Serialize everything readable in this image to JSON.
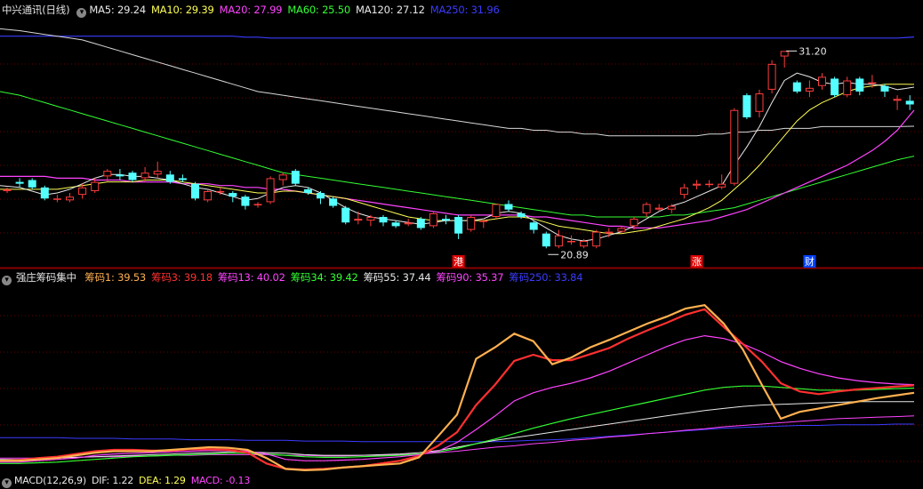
{
  "main_legend": {
    "stock_name": "中兴通讯(日线)",
    "items": [
      {
        "text": "MA5: 29.24",
        "color": "#e8e8e8"
      },
      {
        "text": "MA10: 29.39",
        "color": "#ffff55"
      },
      {
        "text": "MA20: 27.99",
        "color": "#ff44ff"
      },
      {
        "text": "MA60: 25.50",
        "color": "#33ff33"
      },
      {
        "text": "MA120: 27.12",
        "color": "#e8e8e8"
      },
      {
        "text": "MA250: 31.96",
        "color": "#3b3bff"
      }
    ]
  },
  "ind_legend": {
    "name": "强庄筹码集中",
    "items": [
      {
        "text": "筹码1: 39.53",
        "color": "#ffb14f"
      },
      {
        "text": "筹码3: 39.18",
        "color": "#ff3030"
      },
      {
        "text": "筹码13: 40.02",
        "color": "#ff44ff"
      },
      {
        "text": "筹码34: 39.42",
        "color": "#33ff33"
      },
      {
        "text": "筹码55: 37.44",
        "color": "#e8e8e8"
      },
      {
        "text": "筹码90: 35.37",
        "color": "#ff44ff"
      },
      {
        "text": "筹码250: 33.84",
        "color": "#3b3bff"
      }
    ]
  },
  "macd_legend": {
    "items": [
      {
        "text": "MACD(12,26,9)",
        "color": "#e8e8e8"
      },
      {
        "text": "DIF: 1.22",
        "color": "#e8e8e8"
      },
      {
        "text": "DEA: 1.29",
        "color": "#ffff55"
      },
      {
        "text": "MACD: -0.13",
        "color": "#ff44ff"
      }
    ]
  },
  "price_labels": {
    "high": "31.20",
    "low": "20.89"
  },
  "markers": [
    {
      "text": "港",
      "index": 36
    },
    {
      "text": "涨",
      "index": 55
    },
    {
      "text": "财",
      "index": 64
    }
  ],
  "chart_data": {
    "type": "candlestick",
    "y_range": [
      19.5,
      33.0
    ],
    "candles": [
      [
        23.6,
        23.7,
        23.8,
        23.5
      ],
      [
        24.1,
        24.0,
        24.3,
        23.8
      ],
      [
        24.2,
        23.8,
        24.3,
        23.7
      ],
      [
        23.8,
        23.2,
        23.9,
        23.1
      ],
      [
        23.2,
        23.2,
        23.4,
        23.0
      ],
      [
        23.1,
        23.3,
        23.5,
        23.0
      ],
      [
        23.4,
        23.8,
        24.0,
        23.2
      ],
      [
        23.6,
        24.1,
        24.3,
        23.5
      ],
      [
        24.4,
        24.7,
        24.8,
        24.1
      ],
      [
        24.5,
        24.4,
        24.8,
        24.2
      ],
      [
        24.6,
        24.2,
        24.7,
        24.1
      ],
      [
        24.3,
        24.6,
        24.9,
        24.1
      ],
      [
        24.5,
        24.7,
        25.2,
        24.3
      ],
      [
        24.5,
        24.1,
        24.7,
        24.0
      ],
      [
        24.3,
        24.2,
        24.5,
        24.1
      ],
      [
        24.0,
        23.2,
        24.1,
        23.1
      ],
      [
        23.1,
        23.6,
        23.7,
        23.0
      ],
      [
        23.6,
        23.6,
        23.8,
        23.4
      ],
      [
        23.5,
        23.3,
        23.6,
        23.0
      ],
      [
        23.3,
        22.8,
        23.4,
        22.6
      ],
      [
        22.9,
        22.9,
        23.0,
        22.7
      ],
      [
        23.0,
        24.3,
        24.4,
        22.9
      ],
      [
        24.2,
        24.5,
        24.6,
        23.9
      ],
      [
        24.7,
        24.0,
        24.8,
        23.9
      ],
      [
        23.7,
        23.5,
        23.8,
        23.4
      ],
      [
        23.5,
        23.2,
        23.6,
        22.9
      ],
      [
        23.2,
        22.8,
        23.3,
        22.7
      ],
      [
        22.7,
        21.9,
        22.8,
        21.8
      ],
      [
        22.0,
        22.1,
        22.5,
        21.8
      ],
      [
        22.0,
        22.2,
        22.3,
        21.7
      ],
      [
        22.2,
        21.9,
        22.3,
        21.7
      ],
      [
        21.9,
        21.7,
        22.0,
        21.6
      ],
      [
        21.8,
        21.9,
        22.1,
        21.7
      ],
      [
        22.1,
        21.6,
        22.2,
        21.5
      ],
      [
        21.7,
        22.4,
        22.5,
        21.6
      ],
      [
        22.1,
        22.0,
        22.3,
        21.8
      ],
      [
        22.2,
        21.3,
        22.3,
        21.0
      ],
      [
        21.5,
        22.2,
        22.3,
        21.4
      ],
      [
        22.0,
        22.0,
        22.1,
        21.6
      ],
      [
        22.2,
        22.9,
        22.9,
        22.1
      ],
      [
        22.9,
        22.6,
        23.1,
        22.5
      ],
      [
        22.4,
        22.2,
        22.5,
        22.1
      ],
      [
        21.9,
        21.5,
        22.0,
        21.3
      ],
      [
        21.3,
        20.6,
        21.4,
        20.5
      ],
      [
        20.6,
        21.2,
        21.5,
        20.5
      ],
      [
        20.9,
        20.9,
        21.2,
        20.7
      ],
      [
        20.6,
        20.9,
        21.0,
        20.5
      ],
      [
        20.6,
        21.4,
        21.5,
        20.5
      ],
      [
        21.3,
        21.4,
        21.6,
        21.1
      ],
      [
        21.4,
        21.6,
        21.7,
        21.3
      ],
      [
        21.7,
        22.1,
        22.2,
        21.5
      ],
      [
        22.4,
        22.9,
        23.0,
        22.2
      ],
      [
        22.6,
        22.7,
        22.9,
        22.5
      ],
      [
        22.6,
        22.8,
        22.9,
        22.4
      ],
      [
        23.4,
        23.8,
        24.0,
        23.2
      ],
      [
        23.9,
        24.0,
        24.2,
        23.7
      ],
      [
        24.0,
        24.0,
        24.2,
        23.8
      ],
      [
        23.8,
        24.0,
        24.5,
        23.7
      ],
      [
        24.0,
        28.0,
        28.1,
        23.9
      ],
      [
        28.8,
        27.6,
        28.9,
        27.5
      ],
      [
        27.9,
        28.9,
        29.1,
        27.6
      ],
      [
        29.1,
        30.5,
        30.7,
        28.9
      ],
      [
        30.9,
        31.2,
        31.2,
        30.3
      ],
      [
        29.5,
        29.0,
        29.6,
        28.9
      ],
      [
        29.0,
        29.2,
        29.6,
        28.7
      ],
      [
        29.3,
        29.8,
        30.0,
        29.1
      ],
      [
        29.7,
        28.8,
        29.8,
        28.7
      ],
      [
        28.8,
        29.6,
        29.8,
        28.7
      ],
      [
        29.7,
        29.0,
        29.8,
        28.8
      ],
      [
        29.5,
        29.5,
        29.9,
        29.2
      ],
      [
        29.3,
        29.0,
        29.4,
        28.7
      ],
      [
        28.5,
        28.6,
        28.8,
        28.0
      ],
      [
        28.5,
        28.3,
        28.8,
        28.0
      ]
    ],
    "ma5": [
      23.9,
      23.8,
      23.6,
      23.4,
      23.5,
      23.7,
      24.0,
      24.3,
      24.5,
      24.5,
      24.4,
      24.4,
      24.3,
      24.2,
      24.0,
      23.8,
      23.7,
      23.5,
      23.3,
      23.1,
      23.2,
      23.5,
      23.8,
      23.9,
      23.8,
      23.5,
      23.1,
      22.7,
      22.4,
      22.2,
      22.1,
      22.0,
      21.9,
      21.8,
      21.9,
      22.0,
      22.0,
      22.0,
      22.1,
      22.4,
      22.5,
      22.4,
      22.0,
      21.6,
      21.2,
      21.0,
      20.9,
      21.0,
      21.2,
      21.4,
      21.7,
      22.1,
      22.5,
      22.8,
      23.0,
      23.3,
      23.6,
      23.9,
      25.0,
      26.0,
      27.1,
      28.4,
      29.6,
      30.0,
      29.8,
      29.5,
      29.4,
      29.5,
      29.4,
      29.4,
      29.3,
      29.1,
      29.24
    ],
    "ma10": [
      23.7,
      23.7,
      23.7,
      23.7,
      23.7,
      23.8,
      23.9,
      24.0,
      24.1,
      24.1,
      24.1,
      24.2,
      24.2,
      24.2,
      24.1,
      24.0,
      23.9,
      23.8,
      23.7,
      23.6,
      23.5,
      23.5,
      23.6,
      23.6,
      23.5,
      23.4,
      23.3,
      23.2,
      23.0,
      22.8,
      22.6,
      22.4,
      22.2,
      22.1,
      22.0,
      22.0,
      22.0,
      22.0,
      22.0,
      22.1,
      22.2,
      22.2,
      22.1,
      21.9,
      21.7,
      21.6,
      21.5,
      21.4,
      21.3,
      21.3,
      21.4,
      21.5,
      21.7,
      21.9,
      22.1,
      22.4,
      22.7,
      23.1,
      23.7,
      24.3,
      25.0,
      25.8,
      26.6,
      27.4,
      28.0,
      28.4,
      28.7,
      29.0,
      29.2,
      29.3,
      29.4,
      29.4,
      29.39
    ],
    "ma20": [
      24.4,
      24.4,
      24.4,
      24.4,
      24.3,
      24.3,
      24.3,
      24.2,
      24.2,
      24.2,
      24.1,
      24.1,
      24.1,
      24.1,
      24.0,
      24.0,
      24.0,
      23.9,
      23.9,
      23.8,
      23.8,
      23.7,
      23.7,
      23.6,
      23.5,
      23.4,
      23.3,
      23.2,
      23.1,
      23.0,
      22.9,
      22.8,
      22.7,
      22.6,
      22.5,
      22.4,
      22.3,
      22.3,
      22.3,
      22.3,
      22.3,
      22.3,
      22.2,
      22.2,
      22.1,
      22.0,
      21.9,
      21.8,
      21.7,
      21.7,
      21.6,
      21.6,
      21.6,
      21.7,
      21.8,
      21.9,
      22.0,
      22.2,
      22.4,
      22.6,
      22.9,
      23.2,
      23.5,
      23.8,
      24.1,
      24.4,
      24.7,
      25.0,
      25.4,
      25.8,
      26.3,
      26.9,
      27.99
    ],
    "ma60": [
      29.0,
      28.8,
      28.6,
      28.4,
      28.2,
      28.0,
      27.8,
      27.6,
      27.4,
      27.2,
      27.0,
      26.8,
      26.6,
      26.4,
      26.2,
      26.0,
      25.8,
      25.6,
      25.4,
      25.2,
      25.0,
      24.8,
      24.6,
      24.5,
      24.4,
      24.3,
      24.2,
      24.1,
      24.0,
      23.9,
      23.8,
      23.7,
      23.6,
      23.5,
      23.4,
      23.3,
      23.2,
      23.1,
      23.0,
      22.9,
      22.8,
      22.7,
      22.6,
      22.5,
      22.4,
      22.3,
      22.3,
      22.2,
      22.2,
      22.2,
      22.2,
      22.2,
      22.2,
      22.3,
      22.3,
      22.4,
      22.5,
      22.6,
      22.7,
      22.9,
      23.1,
      23.3,
      23.5,
      23.7,
      23.9,
      24.1,
      24.3,
      24.5,
      24.7,
      24.9,
      25.1,
      25.3,
      25.5
    ],
    "ma120": [
      32.4,
      32.3,
      32.2,
      32.1,
      32.0,
      31.9,
      31.8,
      31.6,
      31.4,
      31.2,
      31.0,
      30.8,
      30.6,
      30.4,
      30.2,
      30.0,
      29.8,
      29.6,
      29.4,
      29.2,
      29.0,
      28.9,
      28.8,
      28.7,
      28.6,
      28.5,
      28.4,
      28.3,
      28.2,
      28.1,
      28.0,
      27.9,
      27.8,
      27.7,
      27.6,
      27.5,
      27.4,
      27.3,
      27.2,
      27.1,
      27.0,
      27.0,
      26.9,
      26.9,
      26.8,
      26.8,
      26.7,
      26.7,
      26.6,
      26.6,
      26.6,
      26.6,
      26.6,
      26.6,
      26.6,
      26.6,
      26.7,
      26.7,
      26.8,
      26.8,
      26.9,
      26.9,
      27.0,
      27.0,
      27.0,
      27.1,
      27.1,
      27.1,
      27.1,
      27.1,
      27.1,
      27.1,
      27.12
    ],
    "ma250": [
      32.0,
      32.0,
      32.0,
      32.0,
      32.0,
      32.0,
      32.0,
      32.0,
      32.0,
      32.0,
      32.0,
      32.0,
      32.0,
      32.0,
      32.0,
      32.0,
      32.0,
      32.0,
      32.0,
      31.95,
      31.95,
      31.9,
      31.9,
      31.9,
      31.9,
      31.9,
      31.9,
      31.9,
      31.9,
      31.9,
      31.9,
      31.9,
      31.9,
      31.9,
      31.9,
      31.9,
      31.9,
      31.9,
      31.9,
      31.9,
      31.9,
      31.9,
      31.9,
      31.9,
      31.9,
      31.9,
      31.9,
      31.9,
      31.9,
      31.9,
      31.9,
      31.9,
      31.9,
      31.9,
      31.9,
      31.9,
      31.9,
      31.9,
      31.9,
      31.9,
      31.9,
      31.9,
      31.9,
      31.9,
      31.9,
      31.9,
      31.9,
      31.9,
      31.9,
      31.9,
      31.9,
      31.9,
      31.96
    ],
    "indicator": {
      "y_range": [
        18,
        46
      ],
      "series": [
        {
          "name": "筹码1",
          "color": "#ffb14f",
          "width": 2.2,
          "values": [
            19.8,
            19.8,
            20.0,
            20.2,
            20.6,
            21.0,
            21.2,
            21.2,
            21.2,
            21.4,
            21.6,
            21.8,
            21.7,
            21.4,
            20.2,
            18.6,
            18.4,
            18.5,
            18.8,
            19.0,
            19.2,
            19.4,
            20.3,
            23.4,
            26.6,
            34.8,
            36.5,
            38.5,
            37.4,
            34.0,
            35.0,
            36.5,
            37.6,
            38.8,
            40.0,
            41.0,
            42.2,
            42.7,
            40.0,
            36.2,
            31.0,
            26.0,
            27.0,
            27.5,
            28.0,
            28.5,
            29.0,
            29.4,
            29.8
          ]
        },
        {
          "name": "筹码3",
          "color": "#ff3030",
          "width": 2.2,
          "values": [
            19.8,
            19.9,
            20.2,
            20.4,
            20.8,
            21.2,
            21.4,
            21.4,
            21.3,
            21.3,
            21.5,
            21.5,
            21.4,
            21.0,
            19.4,
            18.6,
            18.5,
            18.6,
            18.8,
            19.0,
            19.4,
            19.8,
            20.5,
            22.0,
            24.0,
            28.0,
            31.0,
            34.5,
            35.4,
            34.6,
            34.6,
            35.5,
            36.4,
            37.8,
            39.0,
            40.1,
            41.3,
            42.1,
            39.5,
            37.0,
            34.4,
            31.2,
            30.0,
            29.6,
            30.0,
            30.3,
            30.5,
            30.7,
            30.9
          ]
        },
        {
          "name": "筹码13",
          "color": "#ff44ff",
          "width": 1.2,
          "values": [
            19.6,
            19.6,
            19.8,
            20.0,
            20.2,
            20.6,
            20.8,
            20.9,
            21.0,
            21.1,
            21.2,
            21.3,
            21.3,
            21.2,
            20.8,
            20.0,
            19.8,
            19.8,
            19.9,
            20.0,
            20.2,
            20.4,
            20.7,
            21.2,
            22.5,
            24.4,
            26.4,
            28.6,
            29.8,
            30.6,
            31.2,
            32.0,
            33.0,
            34.2,
            35.4,
            36.6,
            37.6,
            38.2,
            37.8,
            37.0,
            35.8,
            34.4,
            33.4,
            32.6,
            32.0,
            31.6,
            31.3,
            31.1,
            31.0
          ]
        },
        {
          "name": "筹码34",
          "color": "#33ff33",
          "width": 1.2,
          "values": [
            19.4,
            19.4,
            19.5,
            19.6,
            19.8,
            20.0,
            20.2,
            20.4,
            20.5,
            20.6,
            20.7,
            20.8,
            20.9,
            20.9,
            20.8,
            20.6,
            20.4,
            20.3,
            20.3,
            20.4,
            20.5,
            20.6,
            20.8,
            21.1,
            21.6,
            22.3,
            23.0,
            23.8,
            24.6,
            25.3,
            26.0,
            26.6,
            27.2,
            27.8,
            28.4,
            29.0,
            29.6,
            30.2,
            30.6,
            30.8,
            30.8,
            30.6,
            30.4,
            30.2,
            30.2,
            30.2,
            30.3,
            30.4,
            30.5
          ]
        },
        {
          "name": "筹码55",
          "color": "#e8e8e8",
          "width": 1.0,
          "values": [
            20.0,
            20.0,
            20.1,
            20.2,
            20.3,
            20.4,
            20.5,
            20.6,
            20.7,
            20.8,
            20.9,
            21.0,
            21.1,
            21.1,
            21.0,
            20.9,
            20.7,
            20.6,
            20.6,
            20.6,
            20.7,
            20.8,
            21.0,
            21.3,
            21.8,
            22.3,
            22.8,
            23.2,
            23.6,
            24.0,
            24.4,
            24.8,
            25.2,
            25.6,
            26.0,
            26.4,
            26.8,
            27.2,
            27.5,
            27.8,
            28.0,
            28.1,
            28.2,
            28.3,
            28.4,
            28.5,
            28.5,
            28.5,
            28.5
          ]
        },
        {
          "name": "筹码90",
          "color": "#ff44ff",
          "width": 1.0,
          "values": [
            20.2,
            20.2,
            20.2,
            20.3,
            20.3,
            20.4,
            20.4,
            20.5,
            20.5,
            20.6,
            20.6,
            20.7,
            20.7,
            20.7,
            20.7,
            20.6,
            20.6,
            20.5,
            20.5,
            20.6,
            20.6,
            20.7,
            20.8,
            21.0,
            21.2,
            21.5,
            21.8,
            22.0,
            22.3,
            22.5,
            22.8,
            23.0,
            23.3,
            23.5,
            23.8,
            24.0,
            24.3,
            24.5,
            24.8,
            25.0,
            25.2,
            25.4,
            25.6,
            25.8,
            26.0,
            26.1,
            26.2,
            26.3,
            26.4
          ]
        },
        {
          "name": "筹码250",
          "color": "#3b3bff",
          "width": 1.0,
          "values": [
            23.2,
            23.2,
            23.2,
            23.2,
            23.1,
            23.1,
            23.1,
            23.0,
            23.0,
            23.0,
            22.9,
            22.9,
            22.9,
            22.8,
            22.8,
            22.8,
            22.7,
            22.7,
            22.7,
            22.6,
            22.6,
            22.6,
            22.6,
            22.6,
            22.6,
            22.6,
            22.6,
            22.7,
            22.8,
            22.9,
            23.0,
            23.2,
            23.4,
            23.6,
            23.8,
            24.0,
            24.2,
            24.4,
            24.6,
            24.7,
            24.8,
            24.9,
            25.0,
            25.0,
            25.1,
            25.1,
            25.1,
            25.2,
            25.2
          ]
        }
      ]
    }
  }
}
